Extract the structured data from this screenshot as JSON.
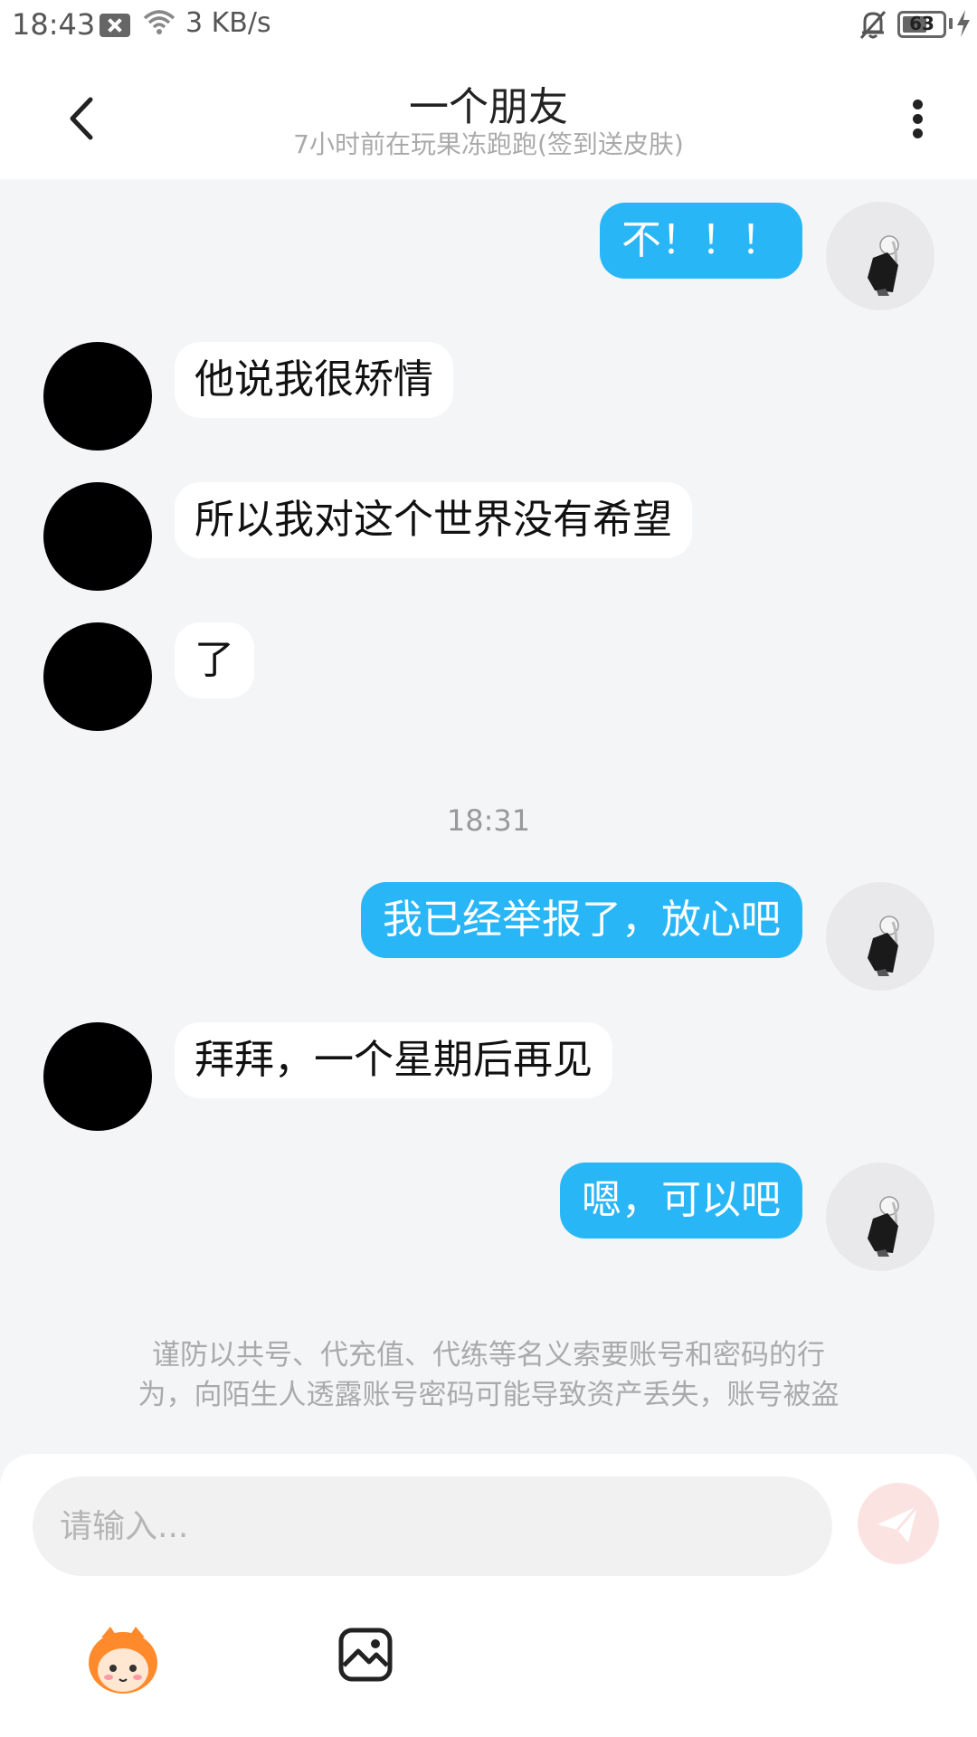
{
  "status_bar": {
    "time": "18:43",
    "network_speed": "3 KB/s",
    "battery": "63",
    "icons": [
      "notification-blocked-icon",
      "wifi-icon",
      "bell-muted-icon",
      "battery-icon",
      "charging-icon"
    ]
  },
  "header": {
    "title": "一个朋友",
    "subtitle": "7小时前在玩果冻跑跑(签到送皮肤)"
  },
  "messages": [
    {
      "side": "self",
      "text": "不！！！"
    },
    {
      "side": "other",
      "text": "他说我很矫情"
    },
    {
      "side": "other",
      "text": "所以我对这个世界没有希望"
    },
    {
      "side": "other",
      "text": "了"
    },
    {
      "side": "self",
      "text": "我已经举报了，放心吧"
    },
    {
      "side": "other",
      "text": "拜拜，一个星期后再见"
    },
    {
      "side": "self",
      "text": "嗯，可以吧"
    }
  ],
  "timestamp": "18:31",
  "notice": {
    "line1": "谨防以共号、代充值、代练等名义索要账号和密码的行",
    "line2": "为，向陌生人透露账号密码可能导致资产丢失，账号被盗"
  },
  "input": {
    "placeholder": "请输入..."
  },
  "colors": {
    "outgoing_bubble": "#29b6f6",
    "incoming_bubble": "#ffffff",
    "chat_background": "#f4f5f7",
    "send_button": "#fbe3e2"
  }
}
